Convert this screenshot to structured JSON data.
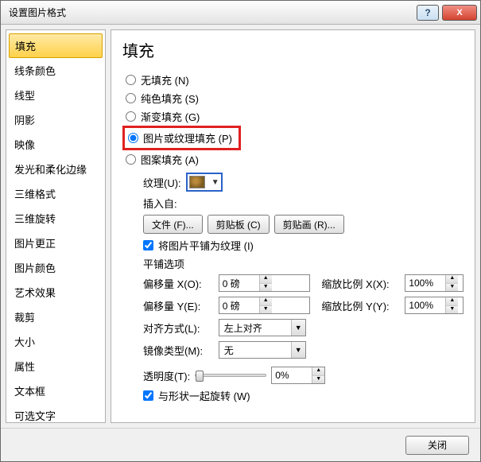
{
  "titlebar": {
    "title": "设置图片格式",
    "help": "?",
    "close": "X"
  },
  "sidebar": {
    "items": [
      {
        "label": "填充",
        "selected": true
      },
      {
        "label": "线条颜色"
      },
      {
        "label": "线型"
      },
      {
        "label": "阴影"
      },
      {
        "label": "映像"
      },
      {
        "label": "发光和柔化边缘"
      },
      {
        "label": "三维格式"
      },
      {
        "label": "三维旋转"
      },
      {
        "label": "图片更正"
      },
      {
        "label": "图片颜色"
      },
      {
        "label": "艺术效果"
      },
      {
        "label": "裁剪"
      },
      {
        "label": "大小"
      },
      {
        "label": "属性"
      },
      {
        "label": "文本框"
      },
      {
        "label": "可选文字"
      }
    ]
  },
  "main": {
    "heading": "填充",
    "radios": {
      "none": "无填充 (N)",
      "solid": "纯色填充 (S)",
      "gradient": "渐变填充 (G)",
      "picture": "图片或纹理填充 (P)",
      "pattern": "图案填充 (A)",
      "selected": "picture"
    },
    "texture_label": "纹理(U):",
    "insert_from_label": "插入自:",
    "btn_file": "文件 (F)...",
    "btn_clip": "剪贴板 (C)",
    "btn_art": "剪贴画 (R)...",
    "tile_check": "将图片平铺为纹理 (I)",
    "tile_heading": "平铺选项",
    "offset_x_label": "偏移量 X(O):",
    "offset_y_label": "偏移量 Y(E):",
    "scale_x_label": "缩放比例 X(X):",
    "scale_y_label": "缩放比例 Y(Y):",
    "offset_x_val": "0 磅",
    "offset_y_val": "0 磅",
    "scale_x_val": "100%",
    "scale_y_val": "100%",
    "align_label": "对齐方式(L):",
    "align_val": "左上对齐",
    "mirror_label": "镜像类型(M):",
    "mirror_val": "无",
    "trans_label": "透明度(T):",
    "trans_val": "0%",
    "rotate_check": "与形状一起旋转 (W)"
  },
  "footer": {
    "close_btn": "关闭"
  }
}
